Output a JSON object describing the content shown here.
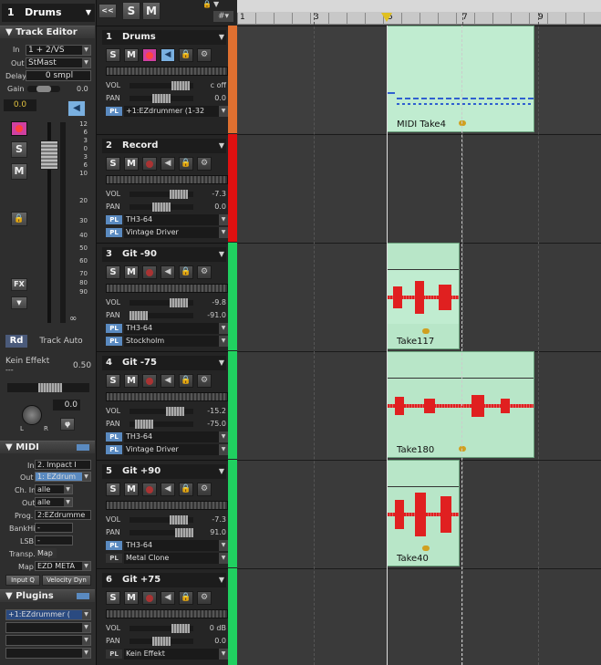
{
  "inspector": {
    "track_selector": {
      "number": "1",
      "name": "Drums"
    },
    "nav_button": "<<",
    "s_button": "S",
    "m_button": "M",
    "track_editor_title": "Track Editor",
    "in_label": "In",
    "in_value": "1 + 2/VS",
    "out_label": "Out",
    "out_value": "StMast",
    "delay_label": "Delay",
    "delay_value": "0 smpl",
    "gain_label": "Gain",
    "gain_value": "0.0",
    "volume_value": "0.0",
    "fader_scale": [
      "12",
      "6",
      "3",
      "0",
      "3",
      "6",
      "10",
      "20",
      "30",
      "40",
      "50",
      "60",
      "70",
      "80",
      "90"
    ],
    "fx_label": "FX",
    "rd_tab": "Rd",
    "track_auto_tab": "Track Auto",
    "effect_name": "Kein Effekt",
    "effect_sub": "---",
    "effect_value": "0.50",
    "pan_value": "0.0",
    "pan_left": "L",
    "pan_right": "R",
    "midi_title": "MIDI",
    "midi_in_label": "In",
    "midi_in_value": "2. Impact I",
    "midi_out_label": "Out",
    "midi_out_value": "1: EZdrum",
    "midi_chin_label": "Ch. In",
    "midi_chin_value": "alle",
    "midi_chout_label": "Out",
    "midi_chout_value": "alle",
    "midi_prog_label": "Prog.",
    "midi_prog_value": "2:EZdrumme",
    "midi_bankhi_label": "BankHi",
    "midi_bankhi_value": "-",
    "midi_lsb_label": "LSB",
    "midi_lsb_value": "-",
    "midi_transp_label": "Transp.",
    "midi_transp_value": "Map",
    "midi_map_label": "Map",
    "midi_map_value": "EZD META",
    "input_q_button": "Input Q",
    "velocity_button": "Velocity Dyn",
    "plugins_title": "Plugins",
    "plugin_slot_1": "+1:EZdrummer (",
    "accent_color": "#5a8ac0"
  },
  "ruler": {
    "marks": [
      "1",
      "3",
      "5",
      "7",
      "9"
    ]
  },
  "tracks": [
    {
      "num": "1",
      "name": "Drums",
      "s": "S",
      "m": "M",
      "vol_label": "VOL",
      "vol": "c off",
      "pan_label": "PAN",
      "pan": "0.0",
      "pl1": "+1:EZdrummer (1-32",
      "color": "#e07030",
      "clip": "MIDI Take4"
    },
    {
      "num": "2",
      "name": "Record",
      "s": "S",
      "m": "M",
      "vol_label": "VOL",
      "vol": "-7.3",
      "pan_label": "PAN",
      "pan": "0.0",
      "pl1": "TH3-64",
      "pl2": "Vintage Driver",
      "color": "#e01010"
    },
    {
      "num": "3",
      "name": "Git  -90",
      "s": "S",
      "m": "M",
      "vol_label": "VOL",
      "vol": "-9.8",
      "pan_label": "PAN",
      "pan": "-91.0",
      "pl1": "TH3-64",
      "pl2": "Stockholm",
      "color": "#20d060",
      "clip": "Take117"
    },
    {
      "num": "4",
      "name": "Git -75",
      "s": "S",
      "m": "M",
      "vol_label": "VOL",
      "vol": "-15.2",
      "pan_label": "PAN",
      "pan": "-75.0",
      "pl1": "TH3-64",
      "pl2": "Vintage Driver",
      "color": "#20d060",
      "clip": "Take180"
    },
    {
      "num": "5",
      "name": "Git +90",
      "s": "S",
      "m": "M",
      "vol_label": "VOL",
      "vol": "-7.3",
      "pan_label": "PAN",
      "pan": "91.0",
      "pl1": "TH3-64",
      "pl2": "Metal Clone",
      "color": "#20d060",
      "clip": "Take40"
    },
    {
      "num": "6",
      "name": "Git +75",
      "s": "S",
      "m": "M",
      "vol_label": "VOL",
      "vol": "0 dB",
      "pan_label": "PAN",
      "pan": "0.0",
      "pl1": "Kein Effekt",
      "color": "#20d060"
    }
  ]
}
